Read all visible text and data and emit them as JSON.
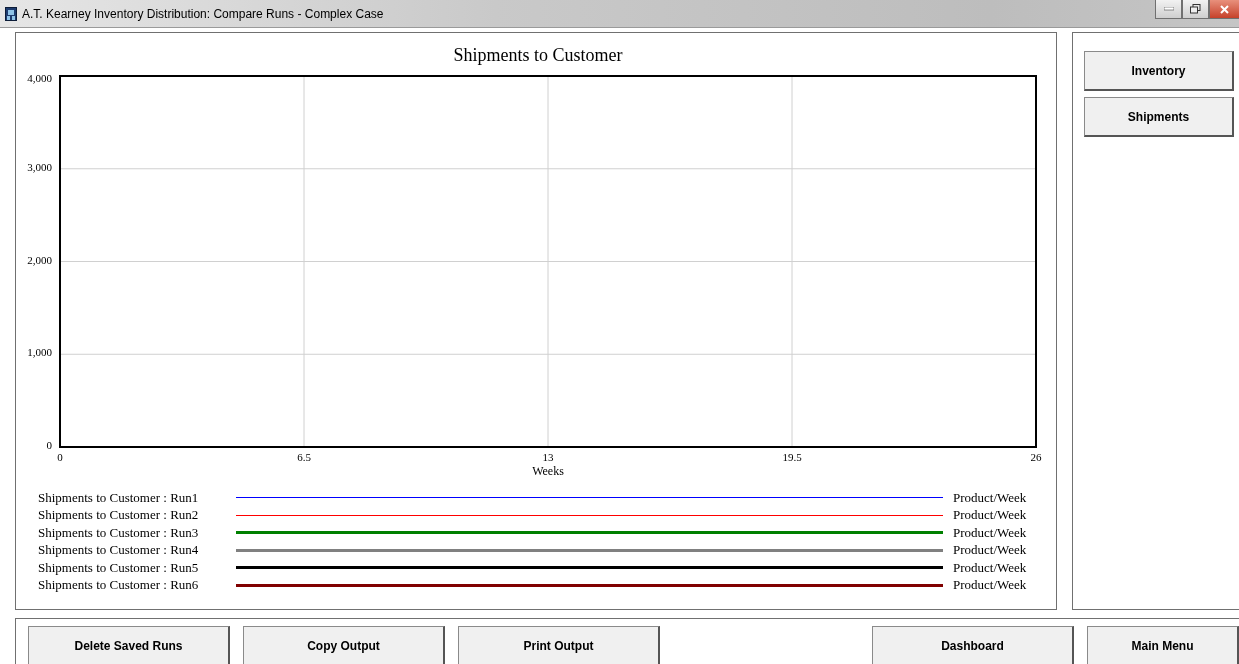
{
  "window": {
    "title": "A.T. Kearney Inventory Distribution: Compare Runs - Complex Case"
  },
  "chart": {
    "chart_data": {
      "type": "line",
      "title": "Shipments to Customer",
      "xlabel": "Weeks",
      "grid": true,
      "categories": [
        "0",
        "6.5",
        "13",
        "19.5",
        "26"
      ],
      "ylim": [
        0,
        4000
      ],
      "yticks": [
        {
          "value": 0,
          "label": "0"
        },
        {
          "value": 1000,
          "label": "1,000"
        },
        {
          "value": 2000,
          "label": "2,000"
        },
        {
          "value": 3000,
          "label": "3,000"
        },
        {
          "value": 4000,
          "label": "4,000"
        }
      ],
      "series": [
        {
          "name": "Shipments to Customer : Run1",
          "color": "#0000ff",
          "values": [
            null,
            null,
            null,
            null,
            null
          ]
        },
        {
          "name": "Shipments to Customer : Run2",
          "color": "#ff0000",
          "values": [
            null,
            null,
            null,
            null,
            null
          ]
        },
        {
          "name": "Shipments to Customer : Run3",
          "color": "#008000",
          "values": [
            null,
            null,
            null,
            null,
            null
          ]
        },
        {
          "name": "Shipments to Customer : Run4",
          "color": "#808080",
          "values": [
            null,
            null,
            null,
            null,
            null
          ]
        },
        {
          "name": "Shipments to Customer : Run5",
          "color": "#000000",
          "values": [
            null,
            null,
            null,
            null,
            null
          ]
        },
        {
          "name": "Shipments to Customer : Run6",
          "color": "#800000",
          "values": [
            null,
            null,
            null,
            null,
            null
          ]
        }
      ]
    },
    "legend": [
      {
        "unit": "Product/Week",
        "kind": "thin"
      },
      {
        "unit": "Product/Week",
        "kind": "thin"
      },
      {
        "unit": "Product/Week",
        "kind": "thick"
      },
      {
        "unit": "Product/Week",
        "kind": "thick"
      },
      {
        "unit": "Product/Week",
        "kind": "thick"
      },
      {
        "unit": "Product/Week",
        "kind": "thick"
      }
    ]
  },
  "side_buttons": [
    "Inventory",
    "Shipments"
  ],
  "bottom_buttons_left": [
    "Delete Saved Runs",
    "Copy Output",
    "Print Output"
  ],
  "bottom_buttons_right": [
    "Dashboard",
    "Main Menu"
  ]
}
